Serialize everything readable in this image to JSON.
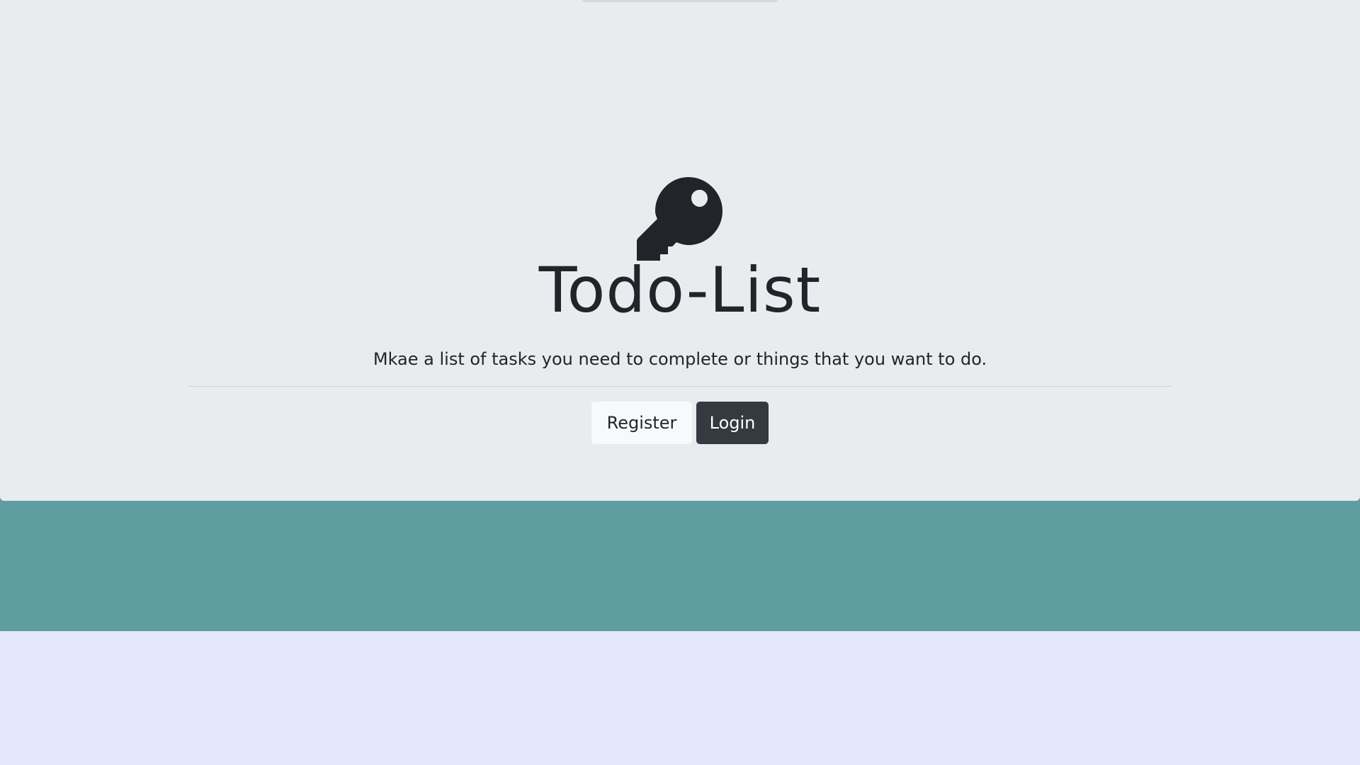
{
  "colors": {
    "jumbotron_bg": "#e9ecef",
    "teal_band": "#5f9ea0",
    "page_bg": "#e3e8fd",
    "text": "#212529",
    "login_button": "#343a40",
    "register_button": "#f8f9fa"
  },
  "hero": {
    "icon": "key-icon",
    "title": "Todo-List",
    "subtitle": "Mkae a list of tasks you need to complete or things that you want to do."
  },
  "buttons": {
    "register_label": "Register",
    "login_label": "Login"
  }
}
